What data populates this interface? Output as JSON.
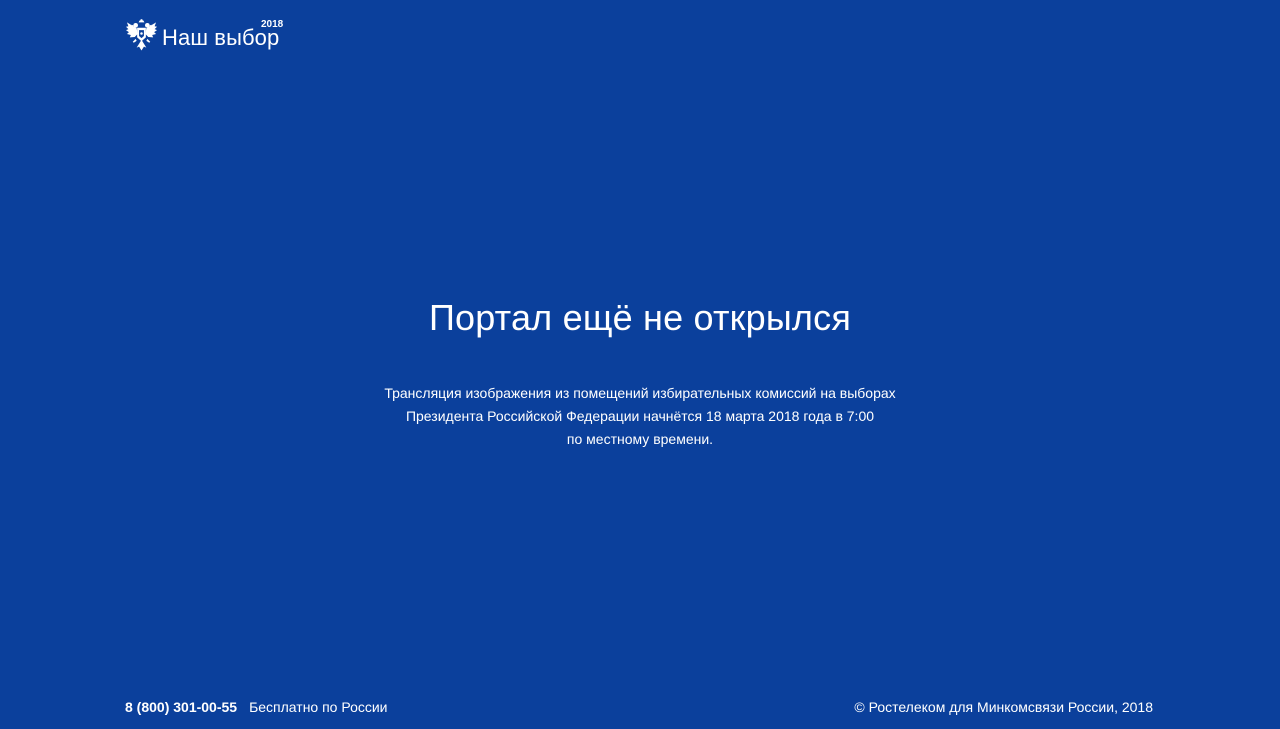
{
  "header": {
    "logo_emblem": "double-headed-eagle-icon",
    "logo_text": "Наш выбор",
    "logo_year": "2018"
  },
  "main": {
    "title": "Портал ещё не открылся",
    "description": [
      "Трансляция изображения из помещений избирательных комиссий на выборах",
      "Президента Российской Федерации начнётся 18 марта 2018 года в 7:00",
      "по местному времени."
    ]
  },
  "footer": {
    "phone": "8 (800) 301-00-55",
    "phone_note": "Бесплатно по России",
    "copyright": "© Ростелеком для Минкомсвязи России, 2018"
  },
  "colors": {
    "background": "#0b409c",
    "text": "#ffffff"
  }
}
